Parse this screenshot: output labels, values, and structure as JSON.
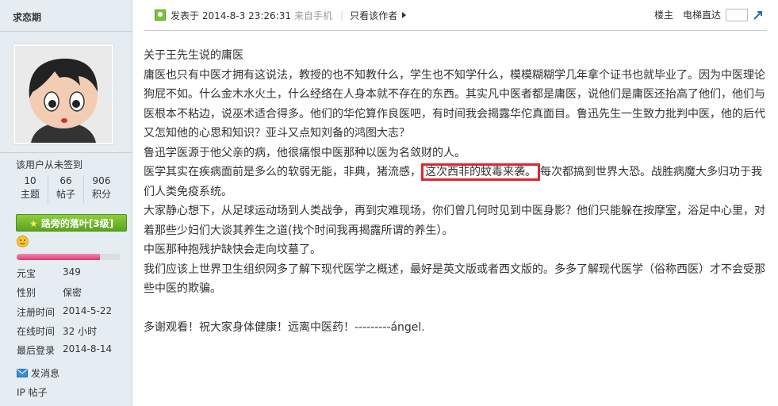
{
  "user": {
    "name": "求恋期",
    "signin_status": "该用户从未签到",
    "stats": [
      {
        "value": "10",
        "label": "主题"
      },
      {
        "value": "66",
        "label": "帖子"
      },
      {
        "value": "906",
        "label": "积分"
      }
    ],
    "rank": "路旁的落叶[3级]",
    "level_progress": 0.8,
    "info": [
      {
        "key": "元宝",
        "value": "349"
      },
      {
        "key": "性别",
        "value": "保密"
      },
      {
        "key": "注册时间",
        "value": "2014-5-22"
      },
      {
        "key": "在线时间",
        "value": "32 小时"
      },
      {
        "key": "最后登录",
        "value": "2014-8-14"
      }
    ],
    "send_message": "发消息",
    "ip_label": "IP 帖子"
  },
  "post": {
    "posted_at": "发表于 2014-8-3 23:26:31",
    "device": "来自手机",
    "only_author": "只看该作者",
    "floor_label": "楼主",
    "jump_label": "电梯直达",
    "paragraphs": [
      "关于王先生说的庸医",
      "庸医也只有中医才拥有这说法，教授的也不知教什么，学生也不知学什么，模模糊糊学几年拿个证书也就毕业了。因为中医理论狗屁不如。什么金木水火土，什么经络在人身本就不存在的东西。其实凡中医者都是庸医，说他们是庸医还抬高了他们，他们与医根本不粘边，说巫术适合得多。他们的华佗算作良医吧，有时间我会揭露华佗真面目。鲁迅先生一生致力批判中医，他的后代又怎知他的心思和知识？亚斗又点知刘备的鸿图大志？",
      "鲁迅学医源于他父亲的病，他很痛恨中医那种以医为名敛财的人。"
    ],
    "para4_before": "医学其实在疾病面前是多么的软弱无能，非典，猪流感，",
    "para4_highlight": "这次西非的蚊毒来袭。",
    "para4_after": "每次都搞到世界大恐。战胜病魔大多归功于我们人类免疫系统。",
    "paragraphs_after": [
      "大家静心想下，从足球运动场到人类战争，再到灾难现场，你们曾几何时见到中医身影？他们只能躲在按摩室，浴足中心里，对着那些少妇们大谈其养生之道(找个时间我再揭露所谓的养生）。",
      "中医那种抱残护缺快会走向坟墓了。",
      "我们应该上世界卫生组织网多了解下现代医学之概述，最好是英文版或者西文版的。多多了解现代医学（俗称西医）才不会受那些中医的欺骗。"
    ],
    "closing": "多谢观看！祝大家身体健康！远离中医药！---------ángel."
  },
  "colors": {
    "sidebar_bg": "#e5edf2",
    "highlight_border": "#e3232f",
    "rank_bg": "#6cb22a"
  }
}
